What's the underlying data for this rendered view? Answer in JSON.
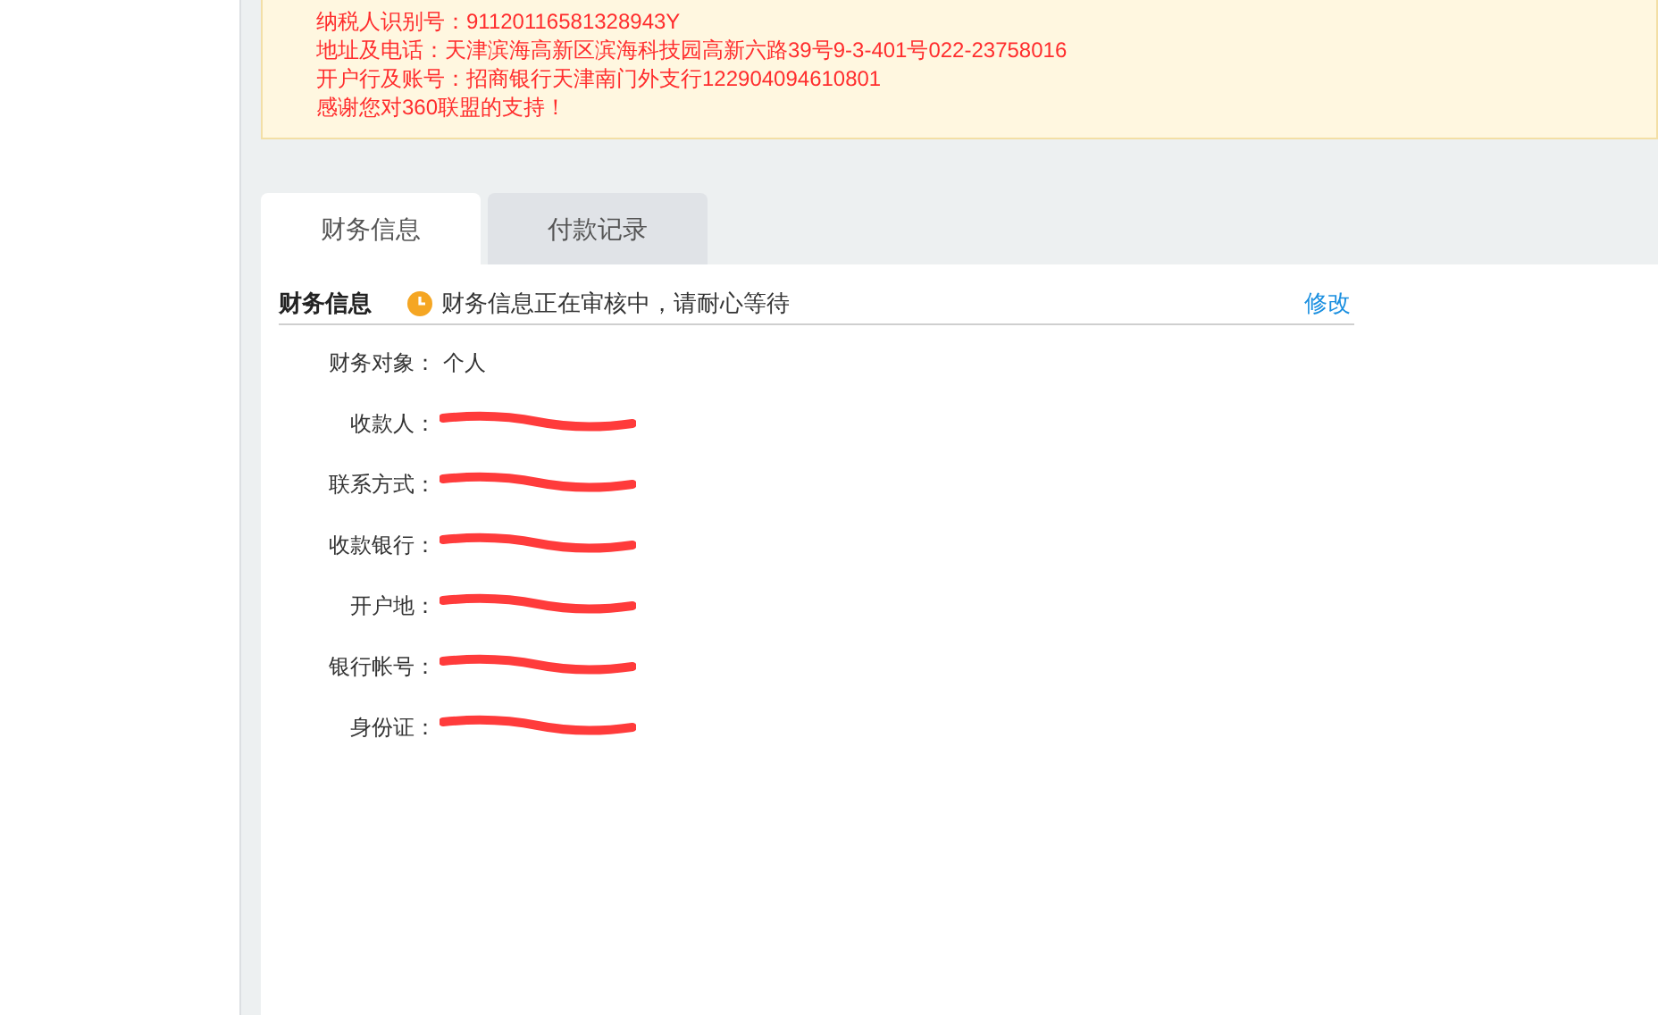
{
  "notice": {
    "lines": [
      "纳税人识别号：91120116581328943Y",
      "地址及电话：天津滨海高新区滨海科技园高新六路39号9-3-401号022-23758016",
      "开户行及账号：招商银行天津南门外支行122904094610801",
      "感谢您对360联盟的支持！"
    ]
  },
  "tabs": [
    {
      "label": "财务信息",
      "selected": true
    },
    {
      "label": "付款记录",
      "selected": false
    }
  ],
  "section": {
    "title": "财务信息",
    "status": "财务信息正在审核中，请耐心等待",
    "edit_link": "修改"
  },
  "fields": [
    {
      "label": "财务对象：",
      "kind": "text",
      "value": "个人"
    },
    {
      "label": "收款人：",
      "kind": "redacted"
    },
    {
      "label": "联系方式：",
      "kind": "redacted"
    },
    {
      "label": "收款银行：",
      "kind": "redacted"
    },
    {
      "label": "开户地：",
      "kind": "redacted"
    },
    {
      "label": "银行帐号：",
      "kind": "redacted"
    },
    {
      "label": "身份证：",
      "kind": "redacted"
    }
  ]
}
